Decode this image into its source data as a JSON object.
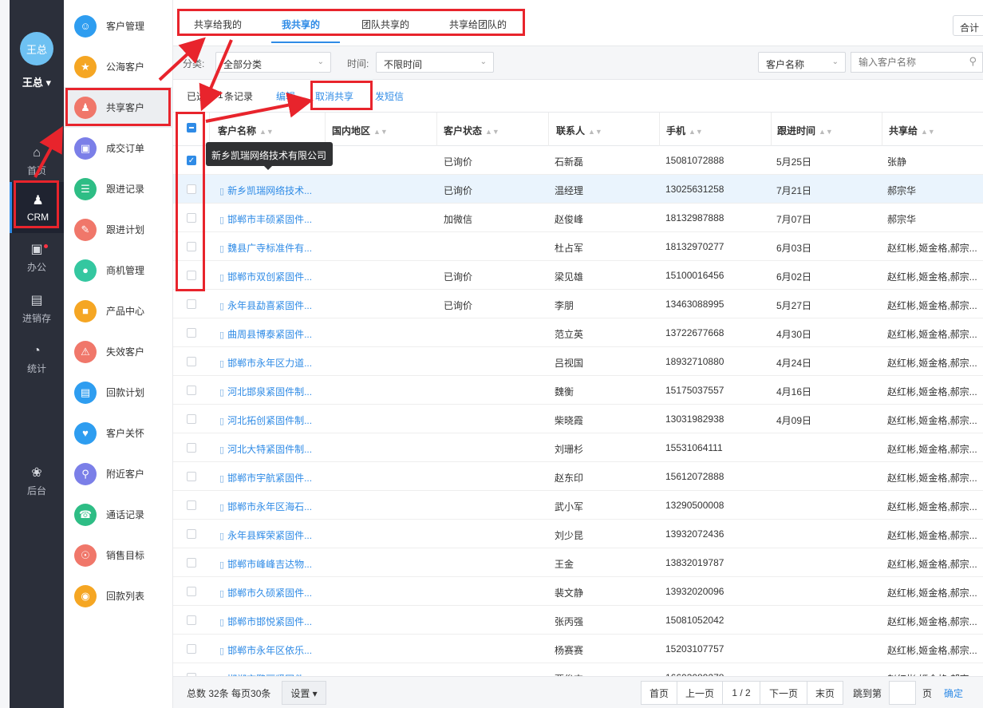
{
  "user": {
    "avatar_text": "王总",
    "name": "王总 ▾"
  },
  "left_nav": [
    {
      "id": "home",
      "label": "首页",
      "icon": "home-icon"
    },
    {
      "id": "crm",
      "label": "CRM",
      "icon": "crm-users-icon"
    },
    {
      "id": "office",
      "label": "办公",
      "icon": "briefcase-icon"
    },
    {
      "id": "inventory",
      "label": "进销存",
      "icon": "warehouse-icon"
    },
    {
      "id": "stats",
      "label": "统计",
      "icon": "pie-chart-icon"
    },
    {
      "id": "backend",
      "label": "后台",
      "icon": "clover-icon"
    }
  ],
  "sub_menu": [
    {
      "label": "客户管理",
      "icon": "customer-icon",
      "color": "#2e9df0"
    },
    {
      "label": "公海客户",
      "icon": "public-customer-icon",
      "color": "#f5a623"
    },
    {
      "label": "共享客户",
      "icon": "shared-customer-icon",
      "color": "#f0776a"
    },
    {
      "label": "成交订单",
      "icon": "order-icon",
      "color": "#7b7fe8"
    },
    {
      "label": "跟进记录",
      "icon": "followup-record-icon",
      "color": "#2ebd85"
    },
    {
      "label": "跟进计划",
      "icon": "followup-plan-icon",
      "color": "#f0776a"
    },
    {
      "label": "商机管理",
      "icon": "opportunity-icon",
      "color": "#34c7a0"
    },
    {
      "label": "产品中心",
      "icon": "product-icon",
      "color": "#f5a623"
    },
    {
      "label": "失效客户",
      "icon": "invalid-customer-icon",
      "color": "#f0776a"
    },
    {
      "label": "回款计划",
      "icon": "payment-plan-icon",
      "color": "#2e9df0"
    },
    {
      "label": "客户关怀",
      "icon": "customer-care-icon",
      "color": "#2e9df0"
    },
    {
      "label": "附近客户",
      "icon": "nearby-customer-icon",
      "color": "#7b7fe8"
    },
    {
      "label": "通话记录",
      "icon": "call-record-icon",
      "color": "#2ebd85"
    },
    {
      "label": "销售目标",
      "icon": "sales-target-icon",
      "color": "#f0776a"
    },
    {
      "label": "回款列表",
      "icon": "payment-list-icon",
      "color": "#f5a623"
    }
  ],
  "tabs": [
    {
      "label": "共享给我的",
      "active": false
    },
    {
      "label": "我共享的",
      "active": true
    },
    {
      "label": "团队共享的",
      "active": false
    },
    {
      "label": "共享给团队的",
      "active": false
    }
  ],
  "tab_right_label": "合计",
  "filters": {
    "category_label": "分类:",
    "category_value": "全部分类",
    "time_label": "时间:",
    "time_value": "不限时间",
    "search_field": "客户名称",
    "search_placeholder": "输入客户名称"
  },
  "actions": {
    "selected_prefix": "已选",
    "selected_count": "1",
    "selected_suffix": "条记录",
    "edit": "编辑",
    "unshare": "取消共享",
    "sms": "发短信"
  },
  "columns": [
    "客户名称",
    "国内地区",
    "客户状态",
    "联系人",
    "手机",
    "跟进时间",
    "共享给"
  ],
  "tooltip": "新乡凯瑞网络技术有限公司",
  "rows": [
    {
      "name": "新乡凯瑞网络技术有限公司",
      "region": "",
      "status": "已询价",
      "contact": "石新磊",
      "phone": "15081072888",
      "time": "5月25日",
      "shared": "张静",
      "checked": true
    },
    {
      "name": "新乡凯瑞网络技术...",
      "region": "",
      "status": "已询价",
      "contact": "温经理",
      "phone": "13025631258",
      "time": "7月21日",
      "shared": "郝宗华",
      "checked": false
    },
    {
      "name": "邯郸市丰硕紧固件...",
      "region": "",
      "status": "加微信",
      "contact": "赵俊峰",
      "phone": "18132987888",
      "time": "7月07日",
      "shared": "郝宗华",
      "checked": false
    },
    {
      "name": "魏县广寺标准件有...",
      "region": "",
      "status": "",
      "contact": "杜占军",
      "phone": "18132970277",
      "time": "6月03日",
      "shared": "赵红彬,姬金格,郝宗...",
      "checked": false
    },
    {
      "name": "邯郸市双创紧固件...",
      "region": "",
      "status": "已询价",
      "contact": "梁见雄",
      "phone": "15100016456",
      "time": "6月02日",
      "shared": "赵红彬,姬金格,郝宗...",
      "checked": false
    },
    {
      "name": "永年县勐喜紧固件...",
      "region": "",
      "status": "已询价",
      "contact": "李朋",
      "phone": "13463088995",
      "time": "5月27日",
      "shared": "赵红彬,姬金格,郝宗...",
      "checked": false
    },
    {
      "name": "曲周县博泰紧固件...",
      "region": "",
      "status": "",
      "contact": "范立英",
      "phone": "13722677668",
      "time": "4月30日",
      "shared": "赵红彬,姬金格,郝宗...",
      "checked": false
    },
    {
      "name": "邯郸市永年区力道...",
      "region": "",
      "status": "",
      "contact": "吕视国",
      "phone": "18932710880",
      "time": "4月24日",
      "shared": "赵红彬,姬金格,郝宗...",
      "checked": false
    },
    {
      "name": "河北邯泉紧固件制...",
      "region": "",
      "status": "",
      "contact": "魏衡",
      "phone": "15175037557",
      "time": "4月16日",
      "shared": "赵红彬,姬金格,郝宗...",
      "checked": false
    },
    {
      "name": "河北拓创紧固件制...",
      "region": "",
      "status": "",
      "contact": "柴晓霞",
      "phone": "13031982938",
      "time": "4月09日",
      "shared": "赵红彬,姬金格,郝宗...",
      "checked": false
    },
    {
      "name": "河北大特紧固件制...",
      "region": "",
      "status": "",
      "contact": "刘珊杉",
      "phone": "15531064111",
      "time": "",
      "shared": "赵红彬,姬金格,郝宗...",
      "checked": false
    },
    {
      "name": "邯郸市宇航紧固件...",
      "region": "",
      "status": "",
      "contact": "赵东印",
      "phone": "15612072888",
      "time": "",
      "shared": "赵红彬,姬金格,郝宗...",
      "checked": false
    },
    {
      "name": "邯郸市永年区海石...",
      "region": "",
      "status": "",
      "contact": "武小军",
      "phone": "13290500008",
      "time": "",
      "shared": "赵红彬,姬金格,郝宗...",
      "checked": false
    },
    {
      "name": "永年县辉荣紧固件...",
      "region": "",
      "status": "",
      "contact": "刘少昆",
      "phone": "13932072436",
      "time": "",
      "shared": "赵红彬,姬金格,郝宗...",
      "checked": false
    },
    {
      "name": "邯郸市峰峰吉达物...",
      "region": "",
      "status": "",
      "contact": "王金",
      "phone": "13832019787",
      "time": "",
      "shared": "赵红彬,姬金格,郝宗...",
      "checked": false
    },
    {
      "name": "邯郸市久硕紧固件...",
      "region": "",
      "status": "",
      "contact": "裴文静",
      "phone": "13932020096",
      "time": "",
      "shared": "赵红彬,姬金格,郝宗...",
      "checked": false
    },
    {
      "name": "邯郸市邯悦紧固件...",
      "region": "",
      "status": "",
      "contact": "张丙强",
      "phone": "15081052042",
      "time": "",
      "shared": "赵红彬,姬金格,郝宗...",
      "checked": false
    },
    {
      "name": "邯郸市永年区依乐...",
      "region": "",
      "status": "",
      "contact": "杨赛赛",
      "phone": "15203107757",
      "time": "",
      "shared": "赵红彬,姬金格,郝宗...",
      "checked": false
    },
    {
      "name": "邯郸市鹏丽紧固件...",
      "region": "",
      "status": "",
      "contact": "贾俊杰",
      "phone": "16603089278",
      "time": "",
      "shared": "赵红彬,姬金格,郝宗...",
      "checked": false
    }
  ],
  "pager": {
    "summary": "总数 32条 每页30条",
    "settings": "设置 ▾",
    "first": "首页",
    "prev": "上一页",
    "page": "1 / 2",
    "next": "下一页",
    "last": "末页",
    "jump_label": "跳到第",
    "page_suffix": "页",
    "confirm": "确定"
  },
  "colors": {
    "accent": "#2f8be6",
    "annotation": "#e8242c",
    "nav_bg": "#2b2f3a"
  }
}
